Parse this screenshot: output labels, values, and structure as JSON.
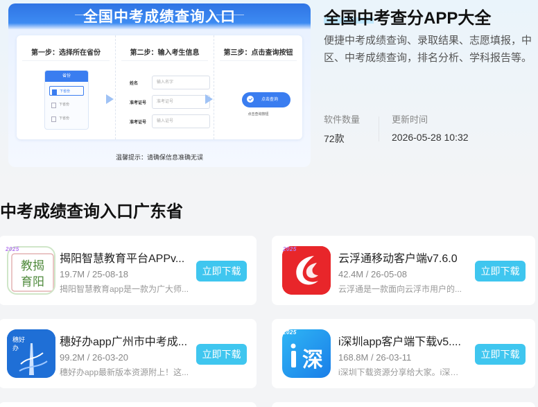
{
  "banner": {
    "title": "全国中考成绩查询入口",
    "steps": [
      {
        "title": "第一步：选择所在省份"
      },
      {
        "title": "第二步：输入考生信息"
      },
      {
        "title": "第三步：点击查询按钮"
      }
    ],
    "province_panel": {
      "header": "省份",
      "items": [
        "下省份",
        "下省份",
        "下省份"
      ]
    },
    "form": [
      {
        "label": "姓名",
        "placeholder": "输入名字"
      },
      {
        "label": "准考证号",
        "placeholder": "准考证号"
      },
      {
        "label": "准考证号",
        "placeholder": "输入证号"
      }
    ],
    "query_button": "点击查询",
    "query_hint": "点击查询按钮",
    "tip": "温馨提示：请确保信息准确无误"
  },
  "hero": {
    "title": "全国中考查分APP大全",
    "description_lines": [
      "便捷中考成绩查询、录取结果、志愿填报，中",
      "区、中考成绩查询，排名分析、学科报告等。"
    ],
    "stats": [
      {
        "label": "软件数量",
        "value": "72款"
      },
      {
        "label": "更新时间",
        "value": "2026-05-28 10:32"
      }
    ]
  },
  "section": {
    "title": "中考成绩查询入口广东省"
  },
  "apps": [
    {
      "name": "揭阳智慧教育平台APPv...",
      "meta": "19.7M / 25-08-18",
      "desc": "揭阳智慧教育app是一款为广大师...",
      "button": "立即下载",
      "icon": "jieyang-education-icon",
      "icon_text": "教揭育阳",
      "badge": "2025"
    },
    {
      "name": "云浮通移动客户端v7.6.0",
      "meta": "42.4M / 26-05-08",
      "desc": "云浮通是一款面向云浮市用户的...",
      "button": "立即下载",
      "icon": "yunfutong-icon",
      "badge": "2025"
    },
    {
      "name": "穗好办app广州市中考成...",
      "meta": "99.2M / 26-03-20",
      "desc": "穗好办app最新版本资源附上！这...",
      "button": "立即下载",
      "icon": "suihaoban-icon",
      "icon_text": "穗好办"
    },
    {
      "name": "i深圳app客户端下载v5....",
      "meta": "168.8M / 26-03-11",
      "desc": "i深圳下载资源分享给大家。i深圳...",
      "button": "立即下载",
      "icon": "ishenzhen-icon",
      "icon_text": "i深",
      "badge": "2025"
    }
  ],
  "colors": {
    "download_button": "#3fc6ef",
    "banner_blue": "#3a7df0",
    "page_background": "#f3f4f6"
  }
}
